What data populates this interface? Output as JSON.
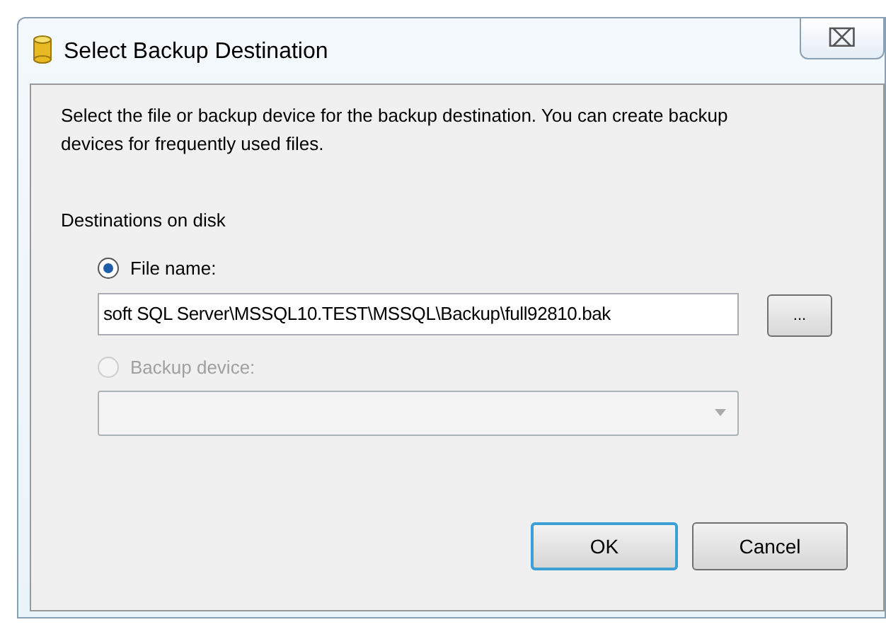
{
  "window": {
    "title": "Select Backup Destination",
    "close": "⌧"
  },
  "description": "Select the file or backup device for the backup destination. You can create backup devices for frequently used files.",
  "group_label": "Destinations on disk",
  "options": [
    {
      "kind": "file",
      "label": "File name:",
      "selected": true,
      "disabled": false,
      "value": "soft SQL Server\\MSSQL10.TEST\\MSSQL\\Backup\\full92810.bak",
      "browse": "..."
    },
    {
      "kind": "device",
      "label": "Backup device:",
      "selected": false,
      "disabled": true
    }
  ],
  "buttons": [
    {
      "label": "OK",
      "default": true
    },
    {
      "label": "Cancel",
      "default": false
    }
  ]
}
